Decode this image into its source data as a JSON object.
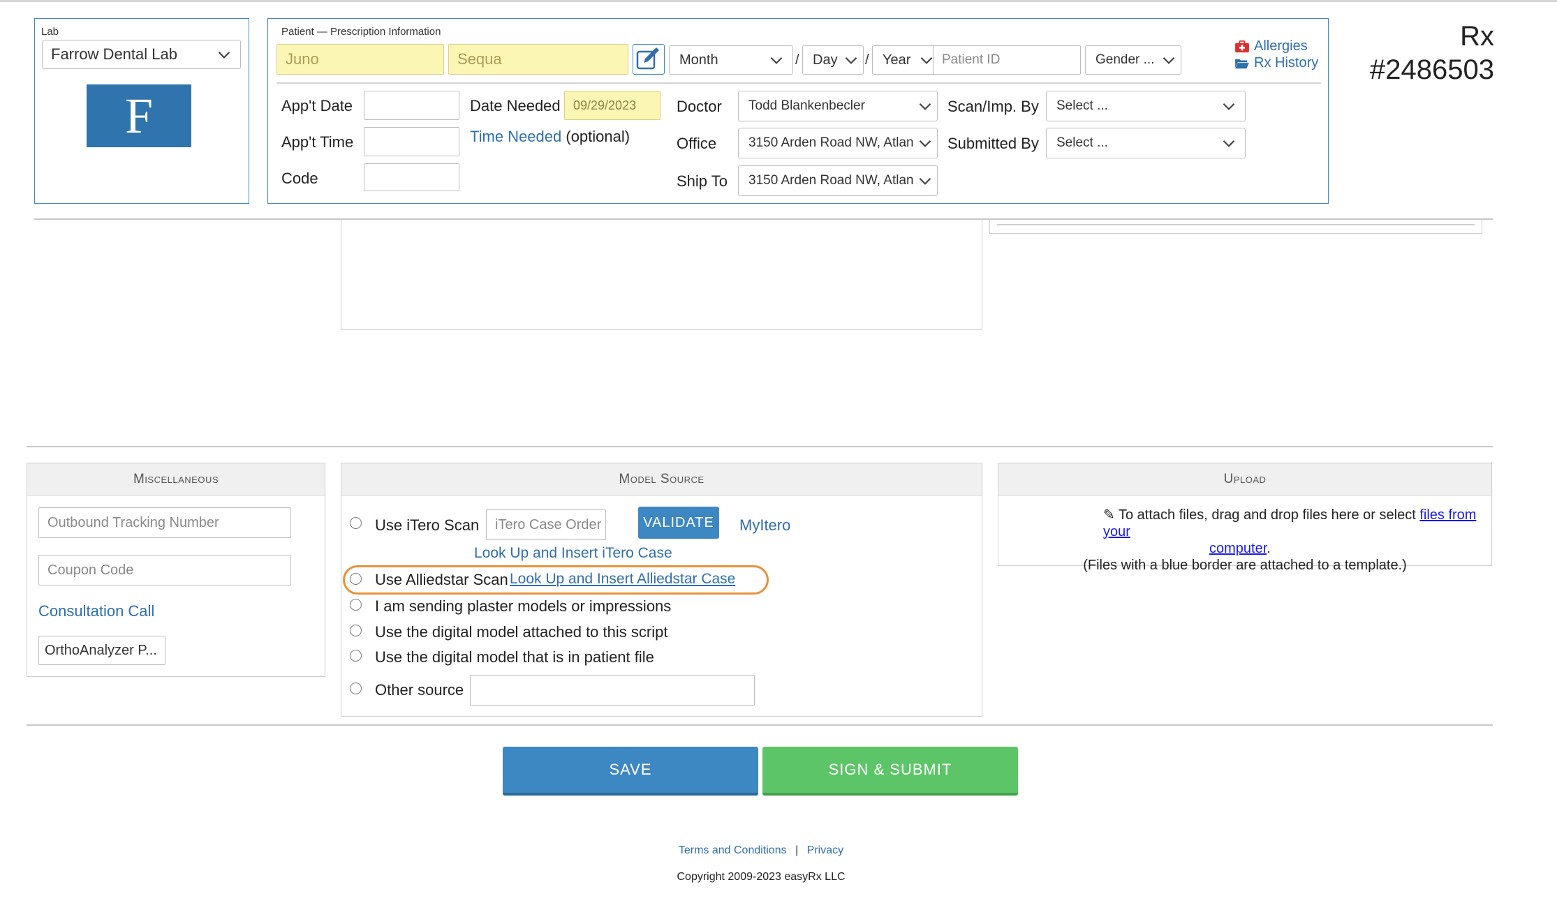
{
  "lab": {
    "label": "Lab",
    "selected": "Farrow Dental Lab",
    "logo_letter": "F"
  },
  "patient": {
    "section_label": "Patient — Prescription Information",
    "first_name": "Juno",
    "last_name": "Sequa",
    "month": "Month",
    "day": "Day",
    "year": "Year",
    "patient_id_placeholder": "Patient ID",
    "gender": "Gender ...",
    "date_sep": "/",
    "allergies": "Allergies",
    "rx_history": "Rx History",
    "appt_date_label": "App't Date",
    "appt_time_label": "App't Time",
    "code_label": "Code",
    "date_needed_label": "Date Needed",
    "date_needed_value": "09/29/2023",
    "time_needed_link": "Time Needed",
    "time_needed_optional": "(optional)",
    "doctor_label": "Doctor",
    "doctor_value": "Todd Blankenbecler",
    "office_label": "Office",
    "office_value": "3150 Arden Road NW, Atlan",
    "ship_to_label": "Ship To",
    "ship_to_value": "3150 Arden Road NW, Atlan",
    "scan_by_label": "Scan/Imp. By",
    "scan_by_value": "Select ...",
    "submitted_by_label": "Submitted By",
    "submitted_by_value": "Select ..."
  },
  "rx": {
    "label": "Rx",
    "number": "#2486503"
  },
  "misc": {
    "title": "Miscellaneous",
    "tracking_placeholder": "Outbound Tracking Number",
    "coupon_placeholder": "Coupon Code",
    "consultation_link": "Consultation Call",
    "ortho_button": "OrthoAnalyzer P..."
  },
  "model_source": {
    "title": "Model Source",
    "itero_label": "Use iTero Scan",
    "itero_placeholder": "iTero Case Order ID",
    "validate": "VALIDATE",
    "myitero": "MyItero",
    "itero_lookup": "Look Up and Insert iTero Case",
    "alliedstar_label": "Use Alliedstar Scan",
    "alliedstar_lookup": "Look Up and Insert Alliedstar Case",
    "plaster": "I am sending plaster models or impressions",
    "digital_attached": "Use the digital model attached to this script",
    "digital_patient": "Use the digital model that is in patient file",
    "other": "Other source"
  },
  "upload": {
    "title": "Upload",
    "line1_pre": "To attach files, drag and drop files here or select",
    "files_link_1": "files from your",
    "files_link_2": "computer",
    "period": ".",
    "line2": "(Files with a blue border are attached to a template.)"
  },
  "actions": {
    "save": "SAVE",
    "sign_submit": "SIGN & SUBMIT"
  },
  "footer": {
    "terms": "Terms and Conditions",
    "sep": "|",
    "privacy": "Privacy",
    "copyright": "Copyright 2009-2023 easyRx LLC"
  },
  "colors": {
    "accent_blue": "#3d88c4",
    "save_button": "#3d87c2",
    "submit_button": "#5cc567",
    "highlight_ring": "#e8923a",
    "link": "#2f6fad",
    "needed_field": "#fbf6b3"
  }
}
